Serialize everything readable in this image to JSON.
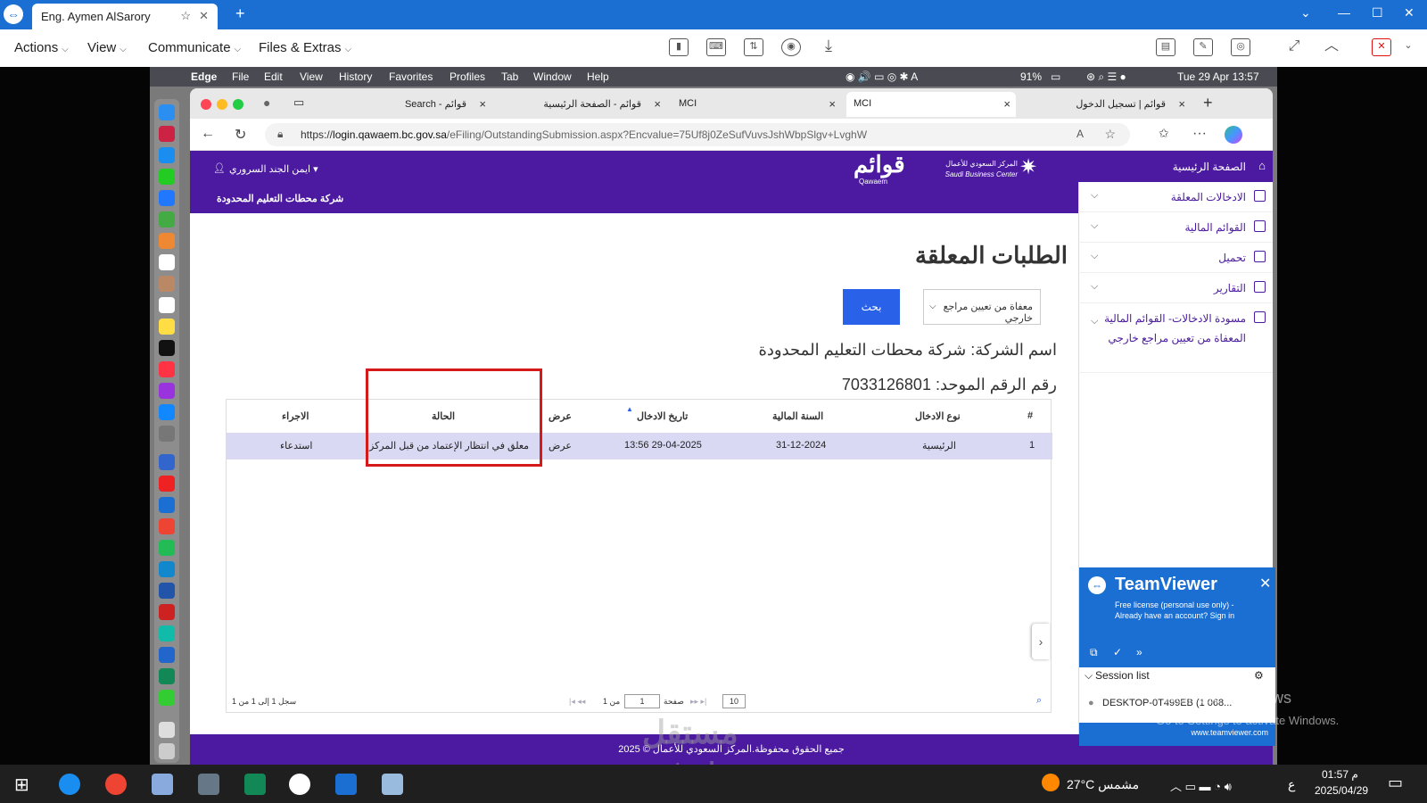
{
  "teamviewer": {
    "tab_title": "Eng. Aymen AlSarory",
    "menus": [
      "Actions",
      "View",
      "Communicate",
      "Files & Extras"
    ]
  },
  "mac": {
    "apple": "",
    "menus": [
      "Edge",
      "File",
      "Edit",
      "View",
      "History",
      "Favorites",
      "Profiles",
      "Tab",
      "Window",
      "Help"
    ],
    "battery": "91%",
    "datetime": "Tue 29 Apr  13:57"
  },
  "edge": {
    "tabs": [
      "Search - قوائم",
      "قوائم - الصفحة الرئيسية",
      "MCI",
      "MCI",
      "قوائم | تسجيل الدخول"
    ],
    "url_scheme": "https://",
    "url_host": "login.qawaem.bc.gov.sa",
    "url_path": "/eFiling/OutstandingSubmission.aspx?Encvalue=75Uf8j0ZeSufVuvsJshWbpSlgv+LvghW"
  },
  "portal": {
    "logo_text": "قوائم",
    "logo_sub": "Qawaem",
    "sbc_ar": "المركز السعودي للأعمال",
    "sbc_en": "Saudi Business Center",
    "user": "ايمن الجند السروري ▾",
    "company_header": "شركة محطات التعليم المحدودة",
    "sidebar": {
      "home": "الصفحة الرئيسية",
      "items": [
        "الادخالات المعلقة",
        "القوائم المالية",
        "تحميل",
        "التقارير"
      ],
      "draft": "مسودة الادخالات- القوائم المالية المعفاة من تعيين مراجع خارجي"
    },
    "page_title": "الطلبات المعلقة",
    "select_value": "معفاة من تعيين مراجع خارجي",
    "search_button": "بحث",
    "company_name": "اسم الشركة: شركة محطات التعليم المحدودة",
    "unified_number": "رقم الرقم الموحد: 7033126801",
    "table": {
      "headers": [
        "#",
        "نوع الادخال",
        "السنة المالية",
        "تاريخ الادخال",
        "عرض",
        "الحالة",
        "الاجراء"
      ],
      "row": [
        "1",
        "الرئيسية",
        "31-12-2024",
        "13:56 29-04-2025",
        "عرض",
        "معلق في انتظار الإعتماد من قبل المركز",
        "استدعاء"
      ]
    },
    "pager": {
      "summary": "سجل 1 إلى 1 من 1",
      "of": "من 1",
      "page_label": "صفحة",
      "page": "1",
      "page_size": "10"
    },
    "footer": "جميع الحقوق محفوظة.المركز السعودي للأعمال © 2025"
  },
  "tv_panel": {
    "title": "TeamViewer",
    "license": "Free license (personal use only) - Already have an account? Sign in",
    "session_list": "Session list",
    "session_item": "DESKTOP-0T499EB (1 068...",
    "url": "www.teamviewer.com"
  },
  "watermark": {
    "activate": "Activate Windows",
    "activate_sub": "Go to Settings to activate Windows.",
    "mostaql_ar": "مستقل",
    "mostaql_en": "mostaql.com"
  },
  "taskbar": {
    "weather": "27°C  مشمس",
    "lang": "ع",
    "time": "01:57 م",
    "date": "2025/04/29"
  }
}
